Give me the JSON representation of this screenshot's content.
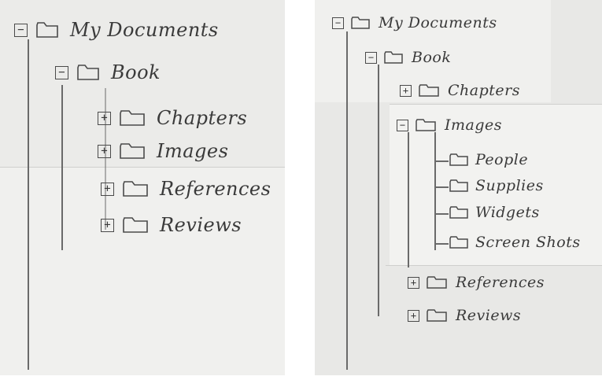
{
  "left_tree": {
    "root": {
      "label": "My Documents",
      "toggle": "−"
    },
    "book": {
      "label": "Book",
      "toggle": "−"
    },
    "children": [
      {
        "label": "Chapters",
        "toggle": "+"
      },
      {
        "label": "Images",
        "toggle": "+"
      },
      {
        "label": "References",
        "toggle": "+"
      },
      {
        "label": "Reviews",
        "toggle": "+"
      }
    ]
  },
  "right_tree": {
    "root": {
      "label": "My Documents",
      "toggle": "−"
    },
    "book": {
      "label": "Book",
      "toggle": "−"
    },
    "chapters": {
      "label": "Chapters",
      "toggle": "+"
    },
    "images": {
      "label": "Images",
      "toggle": "−"
    },
    "image_children": [
      {
        "label": "People"
      },
      {
        "label": "Supplies"
      },
      {
        "label": "Widgets"
      },
      {
        "label": "Screen Shots"
      }
    ],
    "references": {
      "label": "References",
      "toggle": "+"
    },
    "reviews": {
      "label": "Reviews",
      "toggle": "+"
    }
  }
}
